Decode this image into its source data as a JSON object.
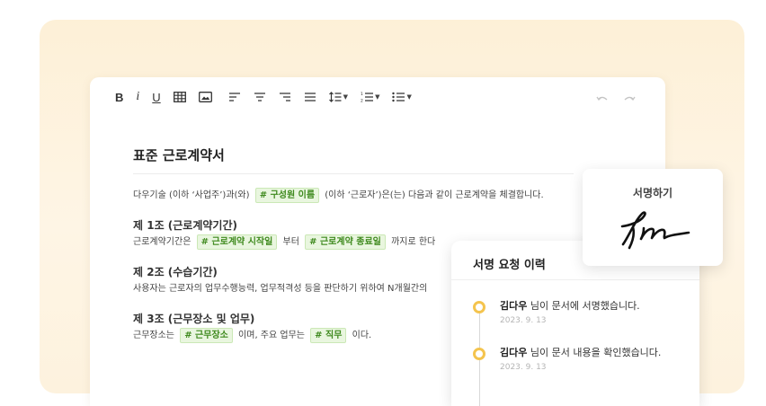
{
  "toolbar": {
    "bold": "B",
    "italic": "i",
    "underline": "U",
    "icons": [
      "table-icon",
      "image-icon",
      "align-left-icon",
      "align-center-icon",
      "align-right-icon",
      "align-justify-icon",
      "line-height-icon",
      "ordered-list-icon",
      "bullet-list-icon",
      "undo-icon",
      "redo-icon"
    ]
  },
  "document": {
    "title": "표준 근로계약서",
    "intro": {
      "before": "다우기술 (이하 ‘사업주’)과(와)",
      "tag": "# 구성원 이름",
      "after": "(이하 ‘근로자’)은(는) 다음과 같이 근로계약을 체결합니다."
    },
    "article1": {
      "title": "제 1조 (근로계약기간)",
      "before": "근로계약기간은",
      "tag1": "# 근로계약 시작일",
      "middle": "부터",
      "tag2": "# 근로계약 종료일",
      "after": "까지로 한다"
    },
    "article2": {
      "title": "제 2조 (수습기간)",
      "text": "사용자는 근로자의 업무수행능력, 업무적격성 등을 판단하기 위하여 N개월간의"
    },
    "article3": {
      "title": "제 3조 (근무장소 및 업무)",
      "before": "근무장소는",
      "tag1": "# 근무장소",
      "middle": "이며, 주요 업무는",
      "tag2": "# 직무",
      "after": "이다."
    }
  },
  "history": {
    "title": "서명 요청 이력",
    "items": [
      {
        "name": "김다우",
        "action": "님이 문서에 서명했습니다.",
        "date": "2023. 9. 13"
      },
      {
        "name": "김다우",
        "action": "님이 문서 내용을 확인했습니다.",
        "date": "2023. 9. 13"
      }
    ]
  },
  "signature": {
    "label": "서명하기",
    "signature_text": "fm"
  },
  "colors": {
    "accent_tag_bg": "#e9f6df",
    "accent_tag_text": "#3f8a1e",
    "timeline_dot": "#f4c44e",
    "background_panel": "#fdf0d7"
  }
}
